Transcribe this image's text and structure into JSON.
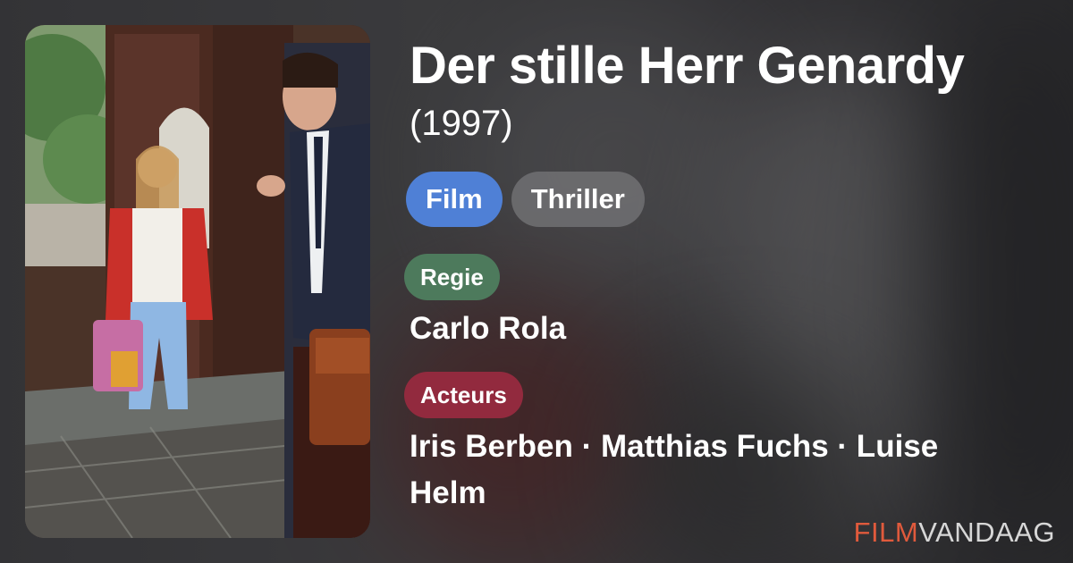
{
  "movie": {
    "title": "Der stille Herr Genardy",
    "year": "(1997)",
    "type_chip": "Film",
    "genre_chip": "Thriller"
  },
  "director": {
    "label": "Regie",
    "value": "Carlo Rola"
  },
  "cast": {
    "label": "Acteurs",
    "value": "Iris Berben · Matthias Fuchs · Luise Helm"
  },
  "brand": {
    "part1": "FILM",
    "part2": "VANDAAG"
  },
  "colors": {
    "film_chip": "#4f80d6",
    "genre_chip": "#6e6e70",
    "regie_label": "#4d7a5c",
    "acteurs_label": "#922a3e",
    "brand_accent": "#e05a3c"
  },
  "poster": {
    "icon": "movie-still-image"
  }
}
